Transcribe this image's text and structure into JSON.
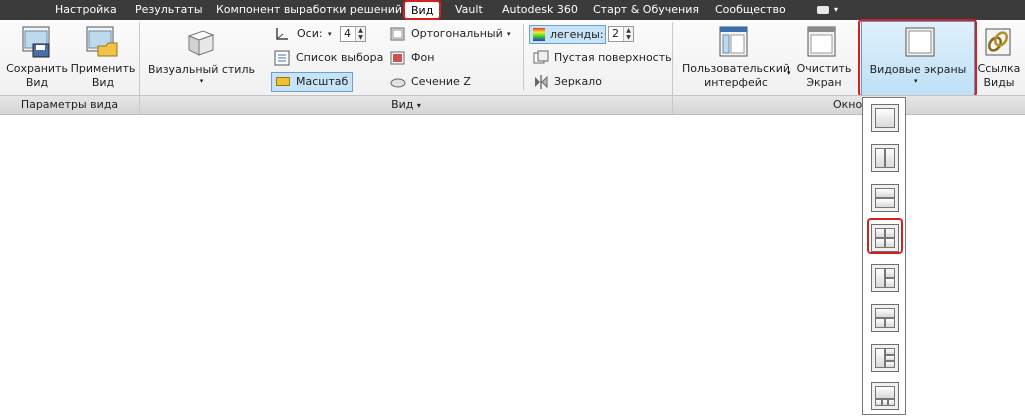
{
  "tabs": [
    "Настройка",
    "Результаты",
    "Компонент выработки решений",
    "Вид",
    "Vault",
    "Autodesk 360",
    "Старт & Обучения",
    "Сообщество"
  ],
  "active_tab": "Вид",
  "panels": {
    "view_params": {
      "label": "Параметры вида",
      "save_view_line1": "Сохранить",
      "save_view_line2": "Вид",
      "apply_view_line1": "Применить",
      "apply_view_line2": "Вид"
    },
    "view": {
      "label": "Вид",
      "visual_style": "Визуальный стиль",
      "axes_label": "Оси:",
      "axes_value": "4",
      "selection_list": "Список выбора",
      "scale": "Масштаб",
      "orthographic": "Ортогональный",
      "background": "Фон",
      "section_z": "Сечение Z",
      "legends_label": "легенды:",
      "legends_value": "2",
      "empty_surface": "Пустая поверхность",
      "mirror": "Зеркало"
    },
    "window": {
      "label": "Окно",
      "user_interface_line1": "Пользовательский",
      "user_interface_line2": "интерфейс",
      "clear_screen_line1": "Очистить",
      "clear_screen_line2": "Экран",
      "viewports_label": "Видовые экраны",
      "link_views_line1": "Ссылка",
      "link_views_line2": "Виды"
    }
  },
  "colors": {
    "tabbar_bg": "#3b3b3b",
    "highlight_red": "#d61f1f",
    "active_blue": "#c7e3f7"
  }
}
